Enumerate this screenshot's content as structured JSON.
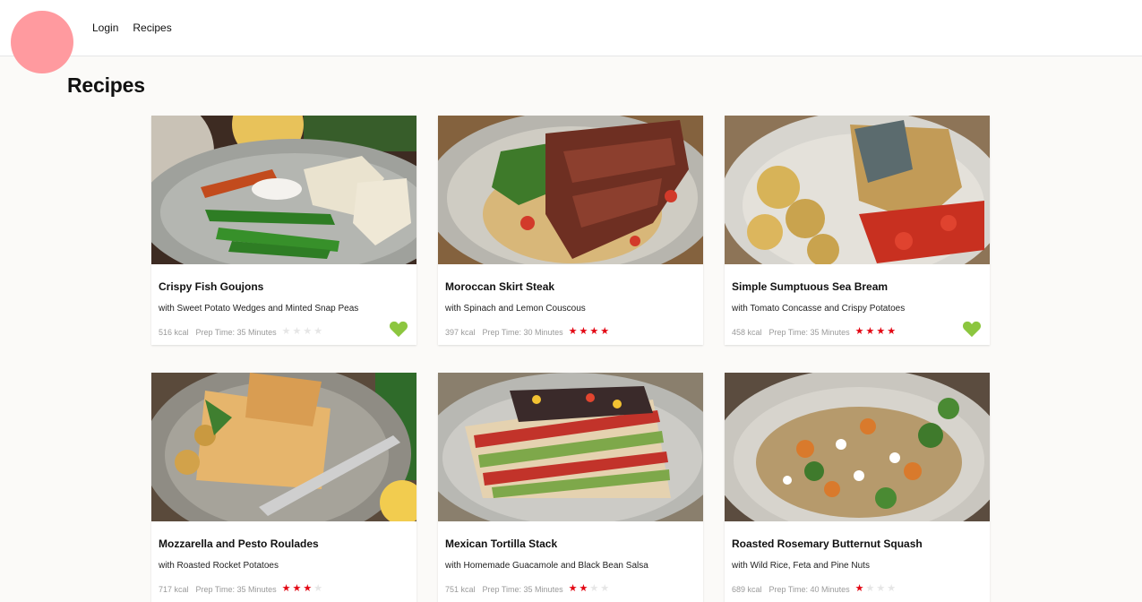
{
  "nav": {
    "login": "Login",
    "recipes": "Recipes"
  },
  "page": {
    "title": "Recipes"
  },
  "colors": {
    "accent": "#ff9a9f",
    "star_on": "#e30613",
    "star_off": "#e6e6e6",
    "heart": "#8cc63f"
  },
  "recipes": [
    {
      "name": "Crispy Fish Goujons",
      "headline": "with Sweet Potato Wedges and Minted Snap Peas",
      "calories": "516 kcal",
      "prep": "Prep Time: 35 Minutes",
      "rating": 0,
      "favorite": true,
      "image": "crispy-fish-goujons-photo"
    },
    {
      "name": "Moroccan Skirt Steak",
      "headline": "with Spinach and Lemon Couscous",
      "calories": "397 kcal",
      "prep": "Prep Time: 30 Minutes",
      "rating": 4,
      "favorite": false,
      "image": "moroccan-skirt-steak-photo"
    },
    {
      "name": "Simple Sumptuous Sea Bream",
      "headline": "with Tomato Concasse and Crispy Potatoes",
      "calories": "458 kcal",
      "prep": "Prep Time: 35 Minutes",
      "rating": 4,
      "favorite": true,
      "image": "sea-bream-photo"
    },
    {
      "name": "Mozzarella and Pesto Roulades",
      "headline": "with Roasted Rocket Potatoes",
      "calories": "717 kcal",
      "prep": "Prep Time: 35 Minutes",
      "rating": 3,
      "favorite": false,
      "image": "mozzarella-pesto-roulades-photo"
    },
    {
      "name": "Mexican Tortilla Stack",
      "headline": "with Homemade Guacamole and Black Bean Salsa",
      "calories": "751 kcal",
      "prep": "Prep Time: 35 Minutes",
      "rating": 2,
      "favorite": false,
      "image": "mexican-tortilla-stack-photo"
    },
    {
      "name": "Roasted Rosemary Butternut Squash",
      "headline": "with Wild Rice, Feta and Pine Nuts",
      "calories": "689 kcal",
      "prep": "Prep Time: 40 Minutes",
      "rating": 1,
      "favorite": false,
      "image": "roasted-butternut-squash-photo"
    }
  ]
}
